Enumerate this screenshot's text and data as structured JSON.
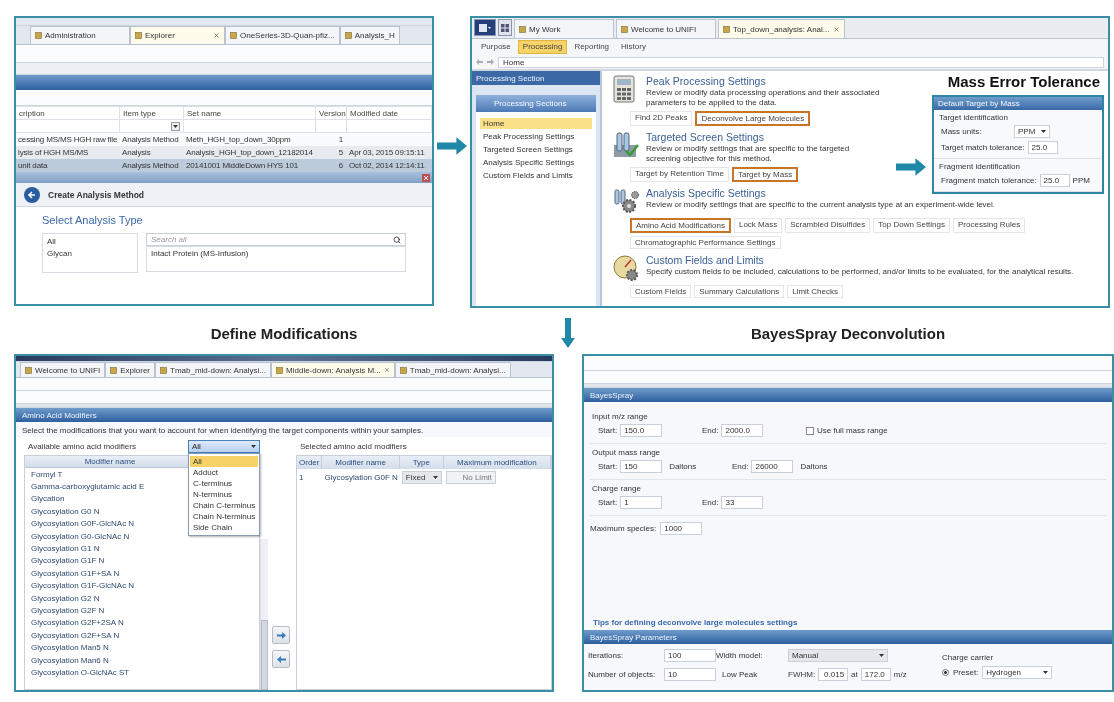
{
  "explorer": {
    "tabs": [
      {
        "label": "Administration",
        "selected": false
      },
      {
        "label": "Explorer",
        "selected": true
      },
      {
        "label": "OneSeries-3D-Quan-pfiz...",
        "selected": false
      },
      {
        "label": "Analysis_H",
        "selected": false
      }
    ],
    "columns": [
      "cription",
      "Item type",
      "Set name",
      "Version",
      "Modified date"
    ],
    "rows": [
      {
        "cells": [
          "cessing MS/MS HGH raw file",
          "Analysis Method",
          "Meth_HGH_top_down_30ppm",
          "1",
          ""
        ],
        "selected": false
      },
      {
        "cells": [
          "lysis of HGH MS/MS",
          "Analysis",
          "Analysis_HGH_top_down_12182014",
          "5",
          "Apr 03, 2015 09:15:11"
        ],
        "selected": false
      },
      {
        "cells": [
          "unit data",
          "Analysis Method",
          "20141001 MiddleDown HYS 101",
          "6",
          "Oct 02, 2014 12:14:11"
        ],
        "selected": true
      }
    ],
    "dialog": {
      "title": "Create Analysis Method",
      "heading": "Select Analysis Type",
      "categories": [
        "All",
        "Glycan"
      ],
      "search_placeholder": "Search all",
      "analysis_types": [
        "Intact Protein (MS-Infusion)"
      ]
    }
  },
  "processing": {
    "app_tabs": [
      {
        "label": "My Work",
        "selected": false
      },
      {
        "label": "Welcome to UNIFI",
        "selected": false
      },
      {
        "label": "Top_down_analysis: Anal...",
        "selected": true
      }
    ],
    "ribbon_tabs": [
      {
        "label": "Purpose",
        "selected": false
      },
      {
        "label": "Processing",
        "selected": true
      },
      {
        "label": "Reporting",
        "selected": false
      },
      {
        "label": "History",
        "selected": false
      }
    ],
    "breadcrumb": "Home",
    "sidebar": {
      "title": "Processing Section",
      "group": "Processing Sections",
      "items": [
        {
          "label": "Home",
          "selected": true
        },
        {
          "label": "Peak Processing Settings",
          "selected": false
        },
        {
          "label": "Targeted Screen Settings",
          "selected": false
        },
        {
          "label": "Analysis Specific Settings",
          "selected": false
        },
        {
          "label": "Custom Fields and Limits",
          "selected": false
        }
      ]
    },
    "sections": [
      {
        "title": "Peak Processing Settings",
        "description": "Review or modify data processing operations and their associated parameters to be applied to the data.",
        "links": [
          {
            "label": "Find 2D Peaks",
            "highlighted": false
          },
          {
            "label": "Deconvolve Large Molecules",
            "highlighted": true
          }
        ]
      },
      {
        "title": "Targeted Screen Settings",
        "description": "Review or modify settings that are specific to the targeted screening objective for this method.",
        "links": [
          {
            "label": "Target by Retention Time",
            "highlighted": false
          },
          {
            "label": "Target by Mass",
            "highlighted": true
          }
        ]
      },
      {
        "title": "Analysis Specific Settings",
        "description": "Review or modify settings that are specific to the current analysis type at an experiment-wide level.",
        "links": [
          {
            "label": "Amino Acid Modifications",
            "highlighted": true
          },
          {
            "label": "Lock Mass",
            "highlighted": false
          },
          {
            "label": "Scrambled Disulfides",
            "highlighted": false
          },
          {
            "label": "Top Down Settings",
            "highlighted": false
          },
          {
            "label": "Processing Rules",
            "highlighted": false
          },
          {
            "label": "Chromatographic Performance Settings",
            "highlighted": false
          }
        ]
      },
      {
        "title": "Custom Fields and Limits",
        "description": "Specify custom fields to be included, calculations to be performed, and/or limits to be evaluated, for the analytical results.",
        "links": [
          {
            "label": "Custom Fields",
            "highlighted": false
          },
          {
            "label": "Summary Calculations",
            "highlighted": false
          },
          {
            "label": "Limit Checks",
            "highlighted": false
          }
        ]
      }
    ],
    "callout": {
      "title": "Mass Error Tolerance",
      "dialog": {
        "title": "Default Target by Mass",
        "groups": [
          {
            "title": "Target identification",
            "fields": [
              {
                "label": "Mass units:",
                "value": "PPM",
                "kind": "dropdown"
              },
              {
                "label": "Target match tolerance:",
                "value": "25.0",
                "kind": "text"
              }
            ]
          },
          {
            "title": "Fragment identification",
            "fields": [
              {
                "label": "Fragment match tolerance:",
                "value": "25.0",
                "unit": "PPM",
                "kind": "text"
              }
            ]
          }
        ]
      }
    }
  },
  "captions": [
    "Define Modifications",
    "BayesSpray Deconvolution"
  ],
  "modifiers": {
    "tabs": [
      {
        "label": "Welcome to UNIFI",
        "selected": false
      },
      {
        "label": "Explorer",
        "selected": false
      },
      {
        "label": "Tmab_mid-down: Analysi...",
        "selected": false
      },
      {
        "label": "Middle-down: Analysis M...",
        "selected": true
      },
      {
        "label": "Tmab_mid-down: Analysi...",
        "selected": false
      }
    ],
    "header": "Amino Acid Modifiers",
    "instruction": "Select the modifications that you want to account for when identifying the target components within your samples.",
    "available_label": "Available amino acid modifiers",
    "filter": {
      "value": "All",
      "options": [
        {
          "label": "All",
          "selected": true
        },
        {
          "label": "Adduct",
          "selected": false
        },
        {
          "label": "C-terminus",
          "selected": false
        },
        {
          "label": "N-terminus",
          "selected": false
        },
        {
          "label": "Chain C-terminus",
          "selected": false
        },
        {
          "label": "Chain N-terminus",
          "selected": false
        },
        {
          "label": "Side Chain",
          "selected": false
        }
      ]
    },
    "list_column": "Modifier name",
    "items": [
      "Formyl T",
      "Gamma-carboxyglutamic acid E",
      "Glycation",
      "Glycosylation G0 N",
      "Glycosylation G0F-GlcNAc N",
      "Glycosylation G0-GlcNAc N",
      "Glycosylation G1 N",
      "Glycosylation G1F N",
      "Glycosylation G1F+SA N",
      "Glycosylation G1F-GlcNAc N",
      "Glycosylation G2 N",
      "Glycosylation G2F N",
      "Glycosylation G2F+2SA N",
      "Glycosylation G2F+SA N",
      "Glycosylation Man5 N",
      "Glycosylation Man6 N",
      "Glycosylation O-GlcNAc ST"
    ],
    "selected_label": "Selected amino acid modifiers",
    "selected_columns": [
      "Order",
      "Modifier name",
      "Type",
      "Maximum modification"
    ],
    "selected_rows": [
      {
        "order": "1",
        "name": "Glycosylation G0F N",
        "type": "Fixed",
        "max": "No Limit"
      }
    ]
  },
  "bayesspray": {
    "header": "BayesSpray",
    "groups": [
      {
        "title": "Input m/z range",
        "fields": [
          {
            "label": "Start:",
            "value": "150.0"
          },
          {
            "label": "End:",
            "value": "2000.0"
          }
        ],
        "checkbox": {
          "label": "Use full mass range",
          "checked": false
        }
      },
      {
        "title": "Output mass range",
        "fields": [
          {
            "label": "Start:",
            "value": "150",
            "unit": "Daltons"
          },
          {
            "label": "End:",
            "value": "26000",
            "unit": "Daltons"
          }
        ]
      },
      {
        "title": "Charge range",
        "fields": [
          {
            "label": "Start:",
            "value": "1"
          },
          {
            "label": "End:",
            "value": "33"
          }
        ]
      }
    ],
    "max_species": {
      "label": "Maximum species:",
      "value": "1000"
    },
    "tips_link": "Tips for defining deconvolve large molecules settings",
    "params_header": "BayesSpray Parameters",
    "params": {
      "iterations": {
        "label": "Iterations:",
        "value": "100"
      },
      "objects": {
        "label": "Number of objects:",
        "value": "10"
      },
      "width_model": {
        "label": "Width model:",
        "value": "Manual"
      },
      "low_peak": {
        "label": "Low Peak",
        "fwhm_label": "FWHM:",
        "fwhm": "0.015",
        "at": "at",
        "mz": "172.0",
        "unit": "m/z"
      },
      "charge_carrier": {
        "title": "Charge carrier",
        "preset_label": "Preset:",
        "preset_selected": true,
        "preset": "Hydrogen"
      }
    }
  }
}
